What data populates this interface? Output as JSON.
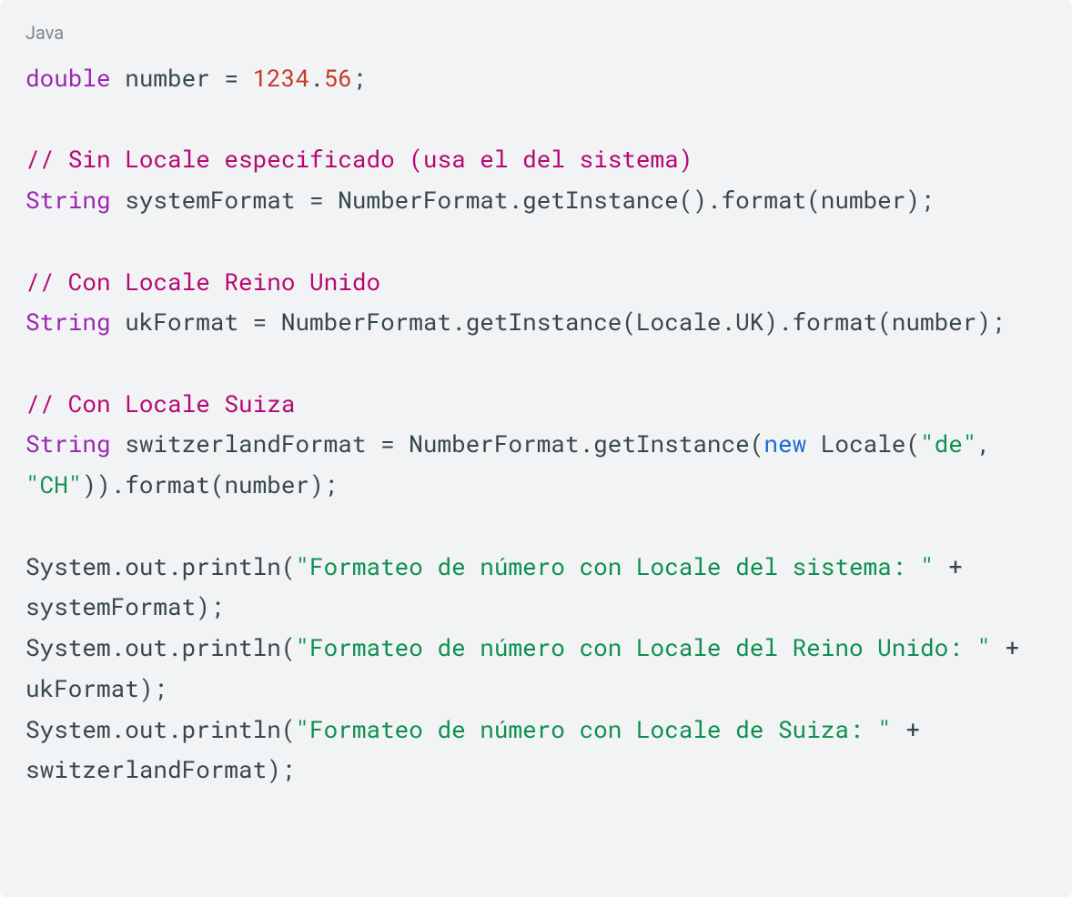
{
  "lang_label": "Java",
  "code": {
    "line1": {
      "kw_double": "double",
      "var": " number = ",
      "num_int": "1234",
      "dot": ".",
      "num_frac": "56",
      "semi": ";"
    },
    "blank1": " ",
    "comment1": "// Sin Locale especificado (usa el del sistema)",
    "line2": {
      "kw_string": "String",
      "rest": " systemFormat = NumberFormat.getInstance().format(number);"
    },
    "blank2": " ",
    "comment2": "// Con Locale Reino Unido",
    "line3": {
      "kw_string": "String",
      "rest": " ukFormat = NumberFormat.getInstance(Locale.UK).format(number);"
    },
    "blank3": " ",
    "comment3": "// Con Locale Suiza",
    "line4": {
      "kw_string": "String",
      "mid": " switzerlandFormat = NumberFormat.getInstance(",
      "kw_new": "new",
      "after_new": " Locale(",
      "str_de": "\"de\"",
      "comma": ", ",
      "str_ch": "\"CH\"",
      "close": ")).format(number);"
    },
    "blank4": " ",
    "line5": {
      "pre": "System.out.println(",
      "str": "\"Formateo de número con Locale del sistema: \"",
      "post": " + systemFormat);"
    },
    "line6": {
      "pre": "System.out.println(",
      "str": "\"Formateo de número con Locale del Reino Unido: \"",
      "post": " + ukFormat);"
    },
    "line7": {
      "pre": "System.out.println(",
      "str": "\"Formateo de número con Locale de Suiza: \"",
      "post": " + switzerlandFormat);"
    }
  }
}
